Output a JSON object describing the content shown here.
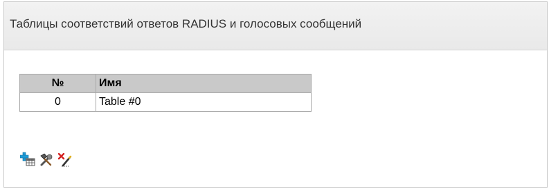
{
  "panel": {
    "title": "Таблицы соответствий ответов RADIUS и голосовых сообщений"
  },
  "table": {
    "headers": {
      "number": "№",
      "name": "Имя"
    },
    "rows": [
      {
        "number": "0",
        "name": "Table #0"
      }
    ]
  },
  "toolbar": {
    "icons": [
      "add-table-icon",
      "edit-tools-icon",
      "delete-edit-icon"
    ]
  },
  "colors": {
    "header_bg": "#c9c9c9",
    "panel_header_bg": "#ececec",
    "add_icon_green": "#2c9fd9",
    "delete_red": "#d42020"
  }
}
